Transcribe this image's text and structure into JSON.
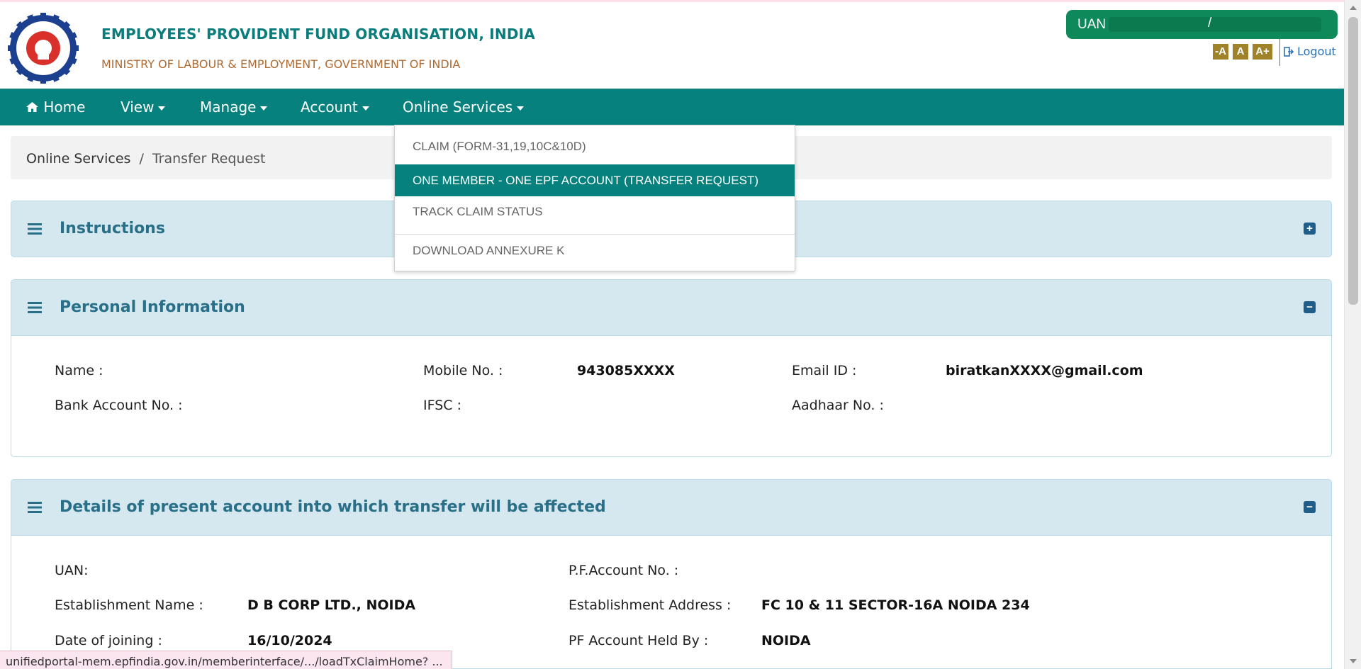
{
  "header": {
    "org_title": "EMPLOYEES' PROVIDENT FUND ORGANISATION, INDIA",
    "org_subtitle": "MINISTRY OF LABOUR & EMPLOYMENT, GOVERNMENT OF INDIA",
    "uan_label": "UAN",
    "uan_separator": "/",
    "font_controls": [
      "-A",
      "A",
      "A+"
    ],
    "logout_label": "Logout"
  },
  "nav": {
    "home": "Home",
    "view": "View",
    "manage": "Manage",
    "account": "Account",
    "online_services": "Online Services"
  },
  "dropdown": {
    "items": [
      "CLAIM (FORM-31,19,10C&10D)",
      "ONE MEMBER - ONE EPF ACCOUNT (TRANSFER REQUEST)",
      "TRACK CLAIM STATUS",
      "DOWNLOAD ANNEXURE K"
    ]
  },
  "breadcrumb": {
    "parent": "Online Services",
    "separator": "/",
    "current": "Transfer Request"
  },
  "instructions": {
    "title": "Instructions",
    "toggle": "+"
  },
  "personal": {
    "title": "Personal Information",
    "toggle": "−",
    "name_label": "Name :",
    "mobile_label": "Mobile No. :",
    "mobile_value": "943085XXXX",
    "email_label": "Email ID :",
    "email_value": "biratkanXXXX@gmail.com",
    "bank_label": "Bank Account No. :",
    "ifsc_label": "IFSC :",
    "aadhaar_label": "Aadhaar No. :"
  },
  "present_account": {
    "title": "Details of present account into which transfer will be affected",
    "toggle": "−",
    "uan_label": "UAN:",
    "pf_label": "P.F.Account No. :",
    "est_name_label": "Establishment Name :",
    "est_name_value": "D B CORP LTD., NOIDA",
    "est_addr_label": "Establishment Address :",
    "est_addr_value": "FC 10 & 11 SECTOR-16A NOIDA 234",
    "doj_label": "Date of joining :",
    "doj_value": "16/10/2024",
    "held_label": "PF Account Held By :",
    "held_value": "NOIDA"
  },
  "status_url": "unifiedportal-mem.epfindia.gov.in/memberinterface/.../loadTxClaimHome? ...",
  "colors": {
    "brand_teal": "#06817e",
    "uan_green": "#0e8a5a",
    "panel_head": "#d5e7ef",
    "panel_title": "#2a6f88",
    "subtitle_brown": "#b06a2f"
  }
}
